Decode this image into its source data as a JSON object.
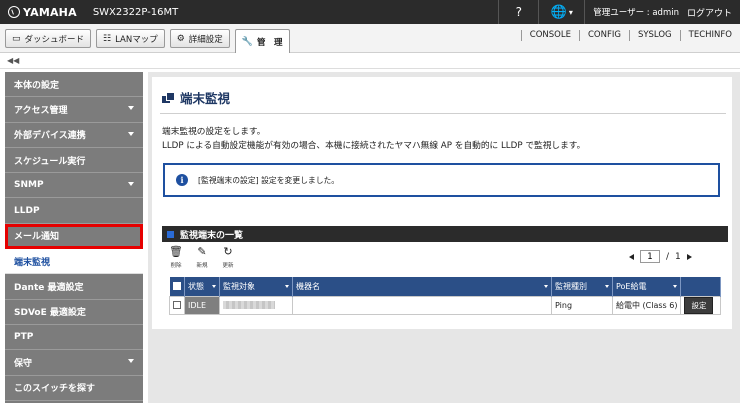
{
  "topbar": {
    "brand": "YAMAHA",
    "model": "SWX2322P-16MT",
    "help_label": "?",
    "lang_label": "▾",
    "user_label": "管理ユーザー : admin",
    "logout_label": "ログアウト"
  },
  "menubar": {
    "tabs": [
      {
        "label": "ダッシュボード",
        "icon": "monitor-icon"
      },
      {
        "label": "LANマップ",
        "icon": "map-icon"
      },
      {
        "label": "詳細設定",
        "icon": "gear-icon"
      },
      {
        "label": "管　理",
        "icon": "wrench-icon"
      }
    ],
    "links": [
      "CONSOLE",
      "CONFIG",
      "SYSLOG",
      "TECHINFO"
    ]
  },
  "sidebar": {
    "items": [
      {
        "label": "本体の設定",
        "chevron": false
      },
      {
        "label": "アクセス管理",
        "chevron": true
      },
      {
        "label": "外部デバイス連携",
        "chevron": true
      },
      {
        "label": "スケジュール実行",
        "chevron": false
      },
      {
        "label": "SNMP",
        "chevron": true
      },
      {
        "label": "LLDP",
        "chevron": false
      },
      {
        "label": "メール通知",
        "chevron": false
      },
      {
        "label": "端末監視",
        "chevron": false
      },
      {
        "label": "Dante 最適設定",
        "chevron": false
      },
      {
        "label": "SDVoE 最適設定",
        "chevron": false
      },
      {
        "label": "PTP",
        "chevron": false
      },
      {
        "label": "保守",
        "chevron": true
      },
      {
        "label": "このスイッチを探す",
        "chevron": false
      }
    ]
  },
  "main": {
    "title": "端末監視",
    "desc_line1": "端末監視の設定をします。",
    "desc_line2": "LLDP による自動設定機能が有効の場合、本機に接続されたヤマハ無線 AP を自動的に LLDP で監視します。",
    "notice": "[監視端末の設定] 設定を変更しました。",
    "list_title": "監視端末の一覧",
    "toolbar": {
      "delete_label": "削除",
      "new_label": "新規",
      "refresh_label": "更新"
    },
    "pager": {
      "current": "1",
      "total": "1",
      "separator": "/"
    },
    "table": {
      "headers": [
        "状態",
        "監視対象",
        "機器名",
        "監視種別",
        "PoE給電"
      ],
      "rows": [
        {
          "state": "IDLE",
          "target": "",
          "name": "",
          "type": "Ping",
          "poe": "給電中 (Class 6)",
          "action": "設定"
        }
      ]
    }
  }
}
